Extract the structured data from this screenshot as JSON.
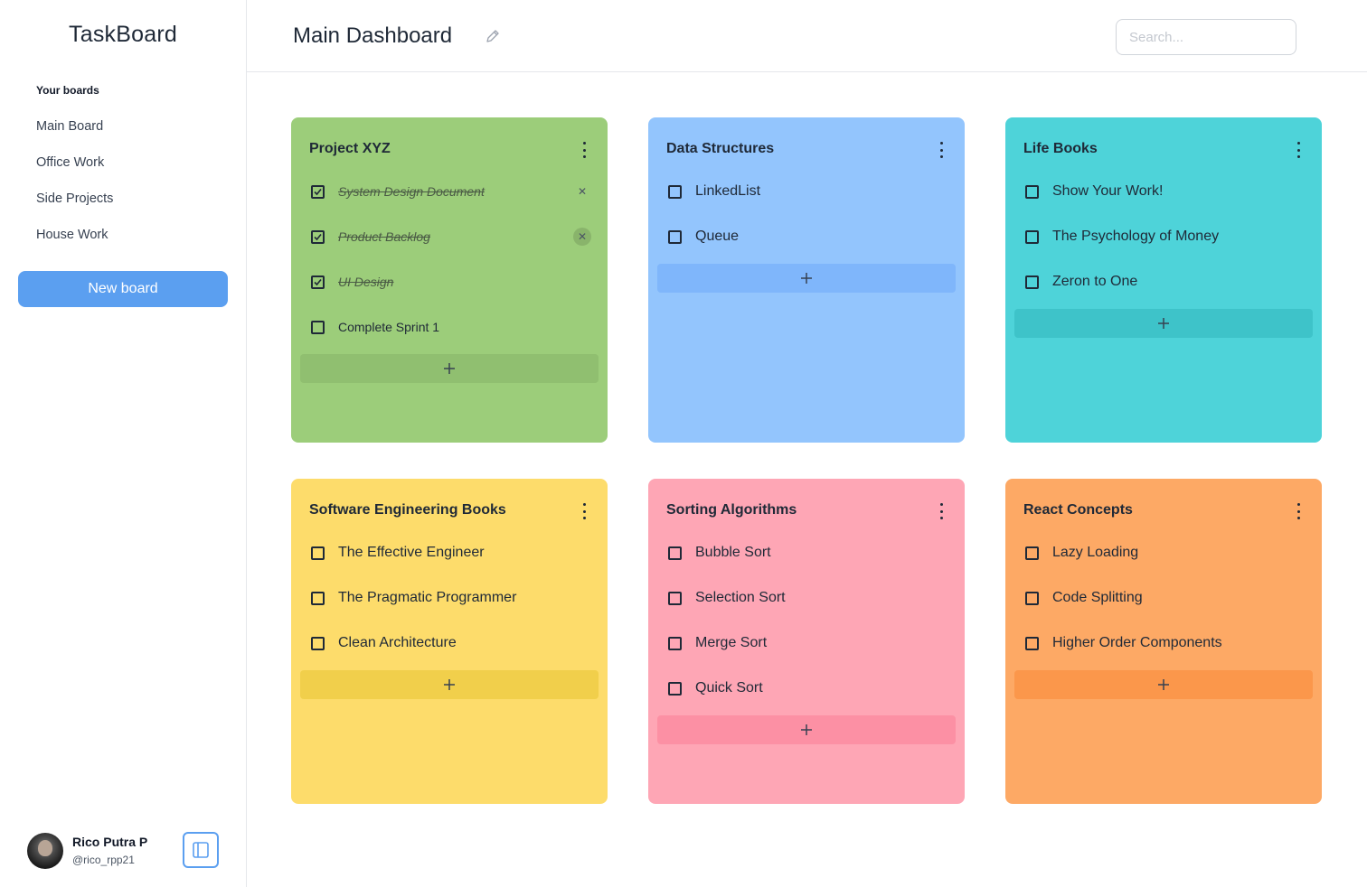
{
  "sidebar": {
    "brand": "TaskBoard",
    "boards_heading": "Your boards",
    "boards": [
      "Main Board",
      "Office Work",
      "Side Projects",
      "House Work"
    ],
    "new_board_label": "New board",
    "user": {
      "name": "Rico Putra P",
      "handle": "@rico_rpp21"
    },
    "panel_toggle_icon": "sidebar-panel-icon"
  },
  "header": {
    "title": "Main Dashboard",
    "edit_icon": "pencil-icon",
    "search_placeholder": "Search..."
  },
  "colors": {
    "primary": "#5b9ff0",
    "green": "#9ccd7a",
    "green_add": "#90bf70",
    "blue": "#93c5fd",
    "blue_add": "#7fb6fb",
    "teal": "#4ed3d9",
    "teal_add": "#3ec3c9",
    "yellow": "#fddc6b",
    "yellow_add": "#f1cf4b",
    "pink": "#fea6b5",
    "pink_add": "#fc90a4",
    "orange": "#fda965",
    "orange_add": "#fb974b"
  },
  "cards": [
    {
      "title": "Project XYZ",
      "tasks": [
        {
          "label": "System Design Document",
          "done": true
        },
        {
          "label": "Product Backlog",
          "done": true
        },
        {
          "label": "UI Design",
          "done": true
        },
        {
          "label": "Complete Sprint 1",
          "done": false
        }
      ]
    },
    {
      "title": "Data Structures",
      "tasks": [
        {
          "label": "LinkedList",
          "done": false
        },
        {
          "label": "Queue",
          "done": false
        }
      ]
    },
    {
      "title": "Life Books",
      "tasks": [
        {
          "label": "Show Your Work!",
          "done": false
        },
        {
          "label": "The Psychology of Money",
          "done": false
        },
        {
          "label": "Zeron to One",
          "done": false
        }
      ]
    },
    {
      "title": "Software Engineering Books",
      "tasks": [
        {
          "label": "The Effective Engineer",
          "done": false
        },
        {
          "label": "The Pragmatic Programmer",
          "done": false
        },
        {
          "label": "Clean Architecture",
          "done": false
        }
      ]
    },
    {
      "title": "Sorting Algorithms",
      "tasks": [
        {
          "label": "Bubble Sort",
          "done": false
        },
        {
          "label": "Selection Sort",
          "done": false
        },
        {
          "label": "Merge Sort",
          "done": false
        },
        {
          "label": "Quick Sort",
          "done": false
        }
      ]
    },
    {
      "title": "React Concepts",
      "tasks": [
        {
          "label": "Lazy Loading",
          "done": false
        },
        {
          "label": "Code Splitting",
          "done": false
        },
        {
          "label": "Higher Order Components",
          "done": false
        }
      ]
    }
  ]
}
